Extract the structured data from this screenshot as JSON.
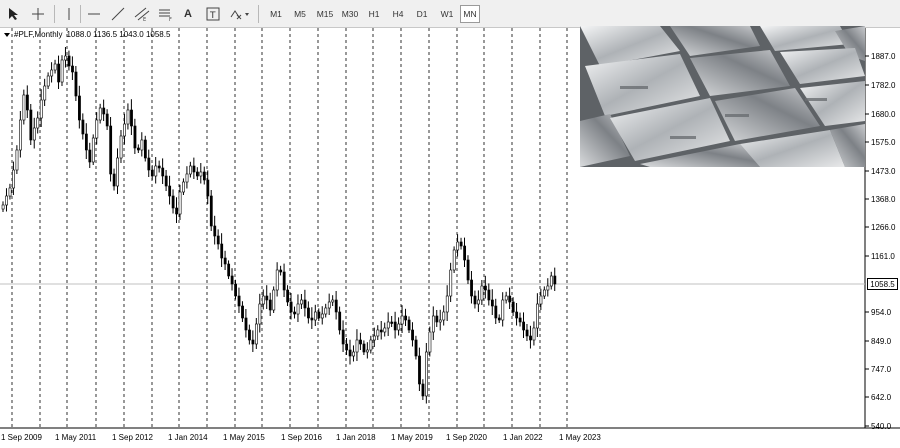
{
  "toolbar": {
    "timeframes": [
      "M1",
      "M5",
      "M15",
      "M30",
      "H1",
      "H4",
      "D1",
      "W1",
      "MN"
    ],
    "active_timeframe": "MN",
    "tools": [
      "cursor-icon",
      "crosshair-icon",
      "vertical-line-icon",
      "horizontal-line-icon",
      "trendline-icon",
      "fibonacci-icon",
      "channel-icon",
      "text-icon",
      "text-label-icon",
      "shapes-icon"
    ]
  },
  "chart": {
    "symbol": "#PLF,Monthly",
    "ohlc": "1088.0 1136.5 1043.0 1058.5",
    "current_price": "1058.5",
    "price_axis": [
      "1887.0",
      "1782.0",
      "1680.0",
      "1575.0",
      "1473.0",
      "1368.0",
      "1266.0",
      "1161.0",
      "954.0",
      "849.0",
      "747.0",
      "642.0",
      "540.0"
    ],
    "time_axis": [
      "1 Sep 2009",
      "1 May 2011",
      "1 Sep 2012",
      "1 Jan 2014",
      "1 May 2015",
      "1 Sep 2016",
      "1 Jan 2018",
      "1 May 2019",
      "1 Sep 2020",
      "1 Jan 2022",
      "1 May 2023"
    ],
    "colors": {
      "candle": "#000000",
      "grid": "#000000",
      "background": "#ffffff"
    }
  },
  "image": {
    "description_icon": "platinum-bars-photo"
  }
}
